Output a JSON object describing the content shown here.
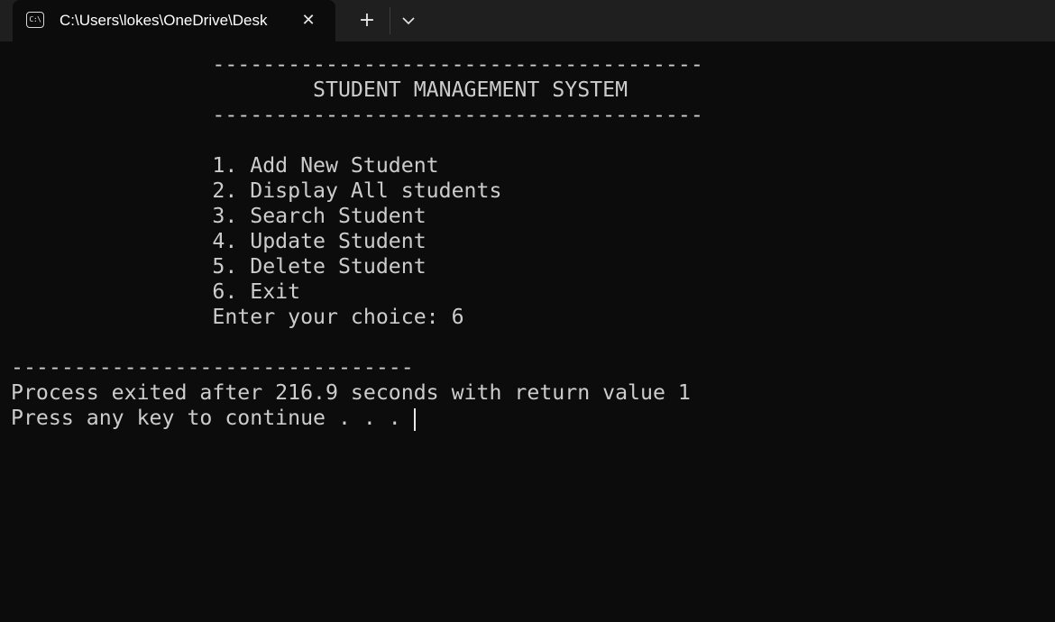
{
  "tab": {
    "icon_text": "C:\\",
    "title": "C:\\Users\\lokes\\OneDrive\\Desk"
  },
  "icons": {
    "tab_icon": "terminal-icon",
    "close": "close-icon",
    "new_tab": "plus-icon",
    "dropdown": "chevron-down-icon"
  },
  "glyphs": {
    "close": "✕",
    "new_tab": "+"
  },
  "terminal": {
    "lines": [
      "                --------------------------------------- ",
      "                        STUDENT MANAGEMENT SYSTEM",
      "                --------------------------------------- ",
      "",
      "                1. Add New Student",
      "                2. Display All students",
      "                3. Search Student",
      "                4. Update Student",
      "                5. Delete Student",
      "                6. Exit",
      "                Enter your choice: 6",
      "",
      "--------------------------------",
      "Process exited after 216.9 seconds with return value 1",
      "Press any key to continue . . . "
    ]
  },
  "colors": {
    "background": "#0c0c0c",
    "tabbar": "#1f1f1f",
    "text": "#cccccc"
  }
}
